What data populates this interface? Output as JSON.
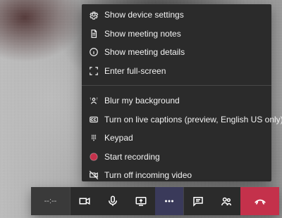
{
  "menu": {
    "items": [
      {
        "label": "Show device settings",
        "icon": "gear-icon"
      },
      {
        "label": "Show meeting notes",
        "icon": "notes-icon"
      },
      {
        "label": "Show meeting details",
        "icon": "info-icon"
      },
      {
        "label": "Enter full-screen",
        "icon": "fullscreen-icon"
      },
      {
        "label": "Blur my background",
        "icon": "blur-icon"
      },
      {
        "label": "Turn on live captions (preview, English US only)",
        "icon": "captions-icon"
      },
      {
        "label": "Keypad",
        "icon": "keypad-icon"
      },
      {
        "label": "Start recording",
        "icon": "record-icon"
      },
      {
        "label": "Turn off incoming video",
        "icon": "video-off-icon"
      }
    ]
  },
  "callbar": {
    "timer": "--:--"
  },
  "colors": {
    "menu_bg": "#2b2b2b",
    "callbar_bg": "#2b2b2b",
    "hangup": "#c4314b",
    "record": "#c4314b"
  }
}
